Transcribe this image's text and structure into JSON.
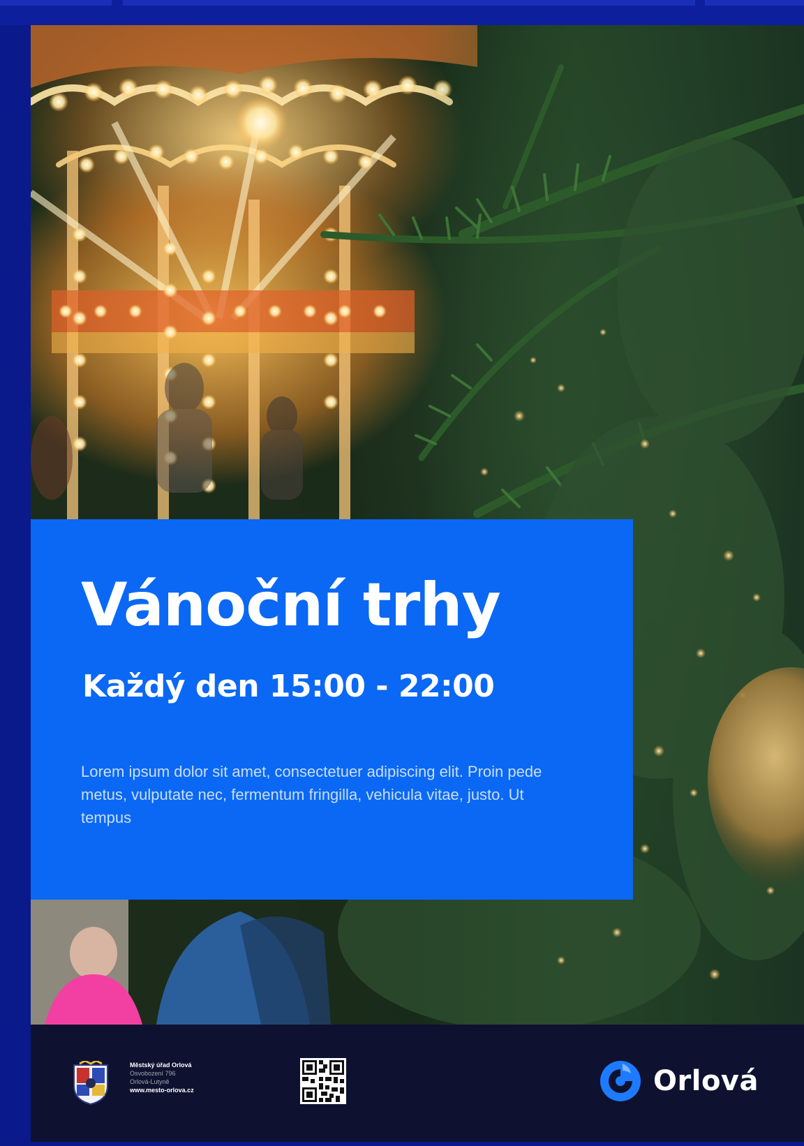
{
  "poster": {
    "title": "Vánoční trhy",
    "subtitle": "Každý den 15:00 - 22:00",
    "body": "Lorem ipsum dolor sit amet, consectetuer adipiscing elit. Proin pede metus, vulputate nec, fermentum fringilla, vehicula vitae, justo. Ut tempus"
  },
  "footer": {
    "address": {
      "line1": "Městský úřad Orlová",
      "line2": "Osvobození 796",
      "line3": "Orlová-Lutyně",
      "line4": "www.mesto-orlova.cz"
    },
    "brand_name": "Orlová",
    "icons": {
      "crest": "city-coat-of-arms",
      "qr": "qr-code",
      "logo": "orlova-logo"
    }
  },
  "colors": {
    "frame": "#0a1a8a",
    "info_box": "#0a68f4",
    "footer": "#0e1230",
    "brand_accent": "#1e7bff"
  }
}
